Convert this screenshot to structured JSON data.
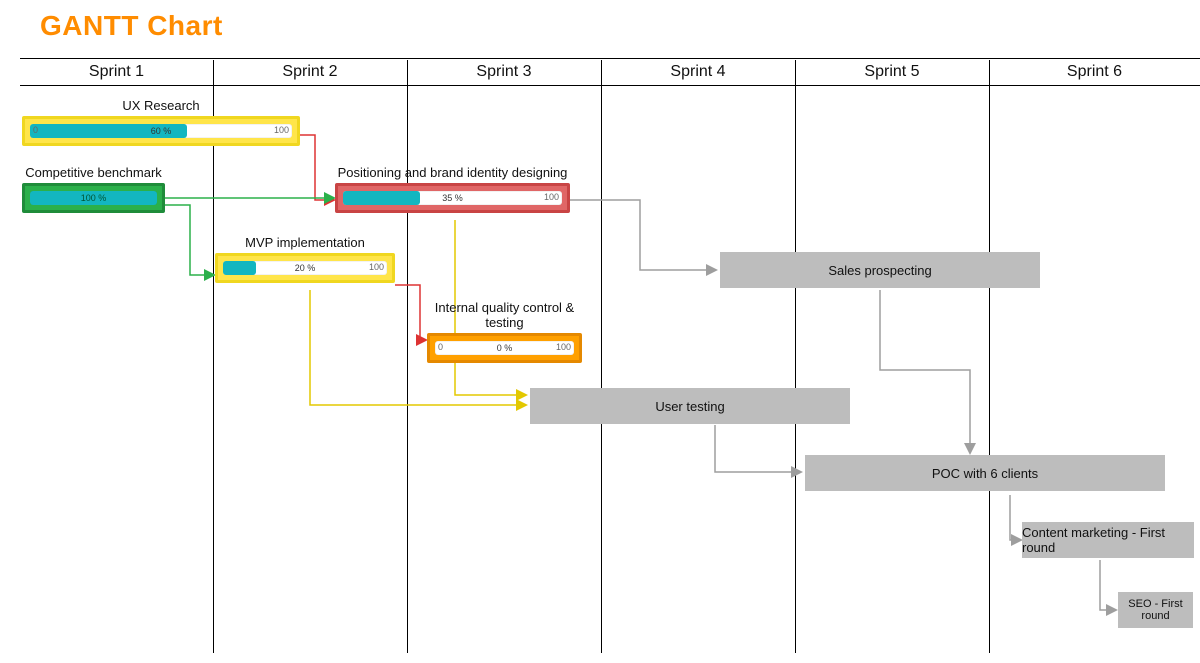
{
  "title": "GANTT Chart",
  "columns": [
    "Sprint 1",
    "Sprint 2",
    "Sprint 3",
    "Sprint 4",
    "Sprint 5",
    "Sprint 6"
  ],
  "tasks": {
    "ux": {
      "label": "UX Research",
      "percent": "60 %",
      "start": "0",
      "end": "100"
    },
    "bench": {
      "label": "Competitive benchmark",
      "percent": "100 %",
      "start": "",
      "end": ""
    },
    "mvp": {
      "label": "MVP implementation",
      "percent": "20 %",
      "start": "",
      "end": "100"
    },
    "brand": {
      "label": "Positioning and brand identity designing",
      "percent": "35 %",
      "start": "",
      "end": "100"
    },
    "qa": {
      "label": "Internal quality control & testing",
      "percent": "0 %",
      "start": "0",
      "end": "100"
    },
    "utest": {
      "label": "User testing"
    },
    "sales": {
      "label": "Sales prospecting"
    },
    "poc": {
      "label": "POC with 6 clients"
    },
    "content": {
      "label": "Content marketing - First round"
    },
    "seo": {
      "label": "SEO - First round"
    }
  },
  "chart_data": {
    "type": "bar",
    "title": "GANTT Chart",
    "xlabel": "Sprint",
    "categories": [
      "Sprint 1",
      "Sprint 2",
      "Sprint 3",
      "Sprint 4",
      "Sprint 5",
      "Sprint 6"
    ],
    "series": [
      {
        "name": "UX Research",
        "start": "Sprint 1",
        "end": "Sprint 2",
        "progress": 60
      },
      {
        "name": "Competitive benchmark",
        "start": "Sprint 1",
        "end": "Sprint 1",
        "progress": 100
      },
      {
        "name": "MVP implementation",
        "start": "Sprint 2",
        "end": "Sprint 3",
        "progress": 20
      },
      {
        "name": "Positioning and brand identity designing",
        "start": "Sprint 2",
        "end": "Sprint 3",
        "progress": 35
      },
      {
        "name": "Internal quality control & testing",
        "start": "Sprint 3",
        "end": "Sprint 3",
        "progress": 0
      },
      {
        "name": "User testing",
        "start": "Sprint 3",
        "end": "Sprint 5"
      },
      {
        "name": "Sales prospecting",
        "start": "Sprint 4",
        "end": "Sprint 6"
      },
      {
        "name": "POC with 6 clients",
        "start": "Sprint 5",
        "end": "Sprint 6"
      },
      {
        "name": "Content marketing - First round",
        "start": "Sprint 6",
        "end": "Sprint 6"
      },
      {
        "name": "SEO - First round",
        "start": "Sprint 6",
        "end": "Sprint 6"
      }
    ],
    "dependencies": [
      [
        "UX Research",
        "Positioning and brand identity designing"
      ],
      [
        "Competitive benchmark",
        "MVP implementation"
      ],
      [
        "Competitive benchmark",
        "Positioning and brand identity designing"
      ],
      [
        "MVP implementation",
        "Internal quality control & testing"
      ],
      [
        "MVP implementation",
        "User testing"
      ],
      [
        "Positioning and brand identity designing",
        "User testing"
      ],
      [
        "Positioning and brand identity designing",
        "Sales prospecting"
      ],
      [
        "User testing",
        "POC with 6 clients"
      ],
      [
        "Sales prospecting",
        "POC with 6 clients"
      ],
      [
        "POC with 6 clients",
        "Content marketing - First round"
      ],
      [
        "Content marketing - First round",
        "SEO - First round"
      ]
    ]
  }
}
